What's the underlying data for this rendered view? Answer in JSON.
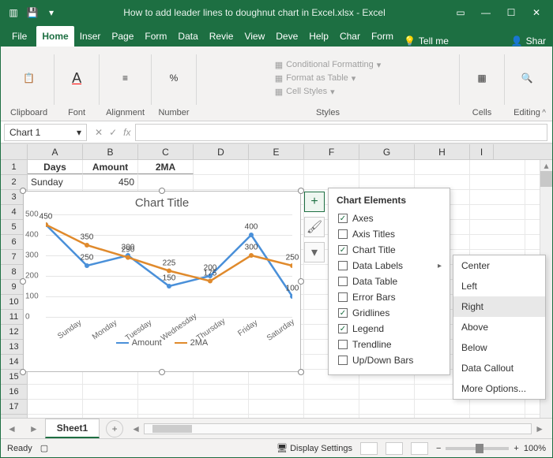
{
  "title": "How to add leader lines to doughnut chart in Excel.xlsx  -  Excel",
  "menu": {
    "file": "File",
    "home": "Home",
    "insert": "Inser",
    "page": "Page",
    "form1": "Form",
    "data": "Data",
    "review": "Revie",
    "view": "View",
    "dev": "Deve",
    "help": "Help",
    "chart": "Char",
    "format": "Form",
    "tell": "Tell me",
    "share": "Shar"
  },
  "ribbon": {
    "clipboard": "Clipboard",
    "font": "Font",
    "alignment": "Alignment",
    "number": "Number",
    "cf": "Conditional Formatting",
    "fat": "Format as Table",
    "cs": "Cell Styles",
    "styles": "Styles",
    "cells": "Cells",
    "editing": "Editing"
  },
  "namebox": "Chart 1",
  "columns": [
    "A",
    "B",
    "C",
    "D",
    "E",
    "F",
    "G",
    "H",
    "I"
  ],
  "headers": {
    "days": "Days",
    "amount": "Amount",
    "ma2": "2MA"
  },
  "row2": {
    "a": "Sunday",
    "b": "450"
  },
  "chart_data": {
    "type": "line",
    "title": "Chart Title",
    "categories": [
      "Sunday",
      "Monday",
      "Tuesday",
      "Wednesday",
      "Thursday",
      "Friday",
      "Saturday"
    ],
    "series": [
      {
        "name": "Amount",
        "color": "#4a90d9",
        "values": [
          450,
          250,
          300,
          150,
          200,
          400,
          100
        ]
      },
      {
        "name": "2MA",
        "color": "#e08a2c",
        "values": [
          450,
          350,
          290,
          225,
          175,
          300,
          250
        ]
      }
    ],
    "ylim": [
      0,
      500
    ],
    "yticks": [
      0,
      100,
      200,
      300,
      400,
      500
    ],
    "data_labels": [
      {
        "x": 0,
        "y": 450,
        "text": "450"
      },
      {
        "x": 1,
        "y": 350,
        "text": "350"
      },
      {
        "x": 1,
        "y": 250,
        "text": "250"
      },
      {
        "x": 2,
        "y": 290,
        "text": "290"
      },
      {
        "x": 2,
        "y": 300,
        "text": "300"
      },
      {
        "x": 3,
        "y": 225,
        "text": "225"
      },
      {
        "x": 3,
        "y": 150,
        "text": "150"
      },
      {
        "x": 4,
        "y": 200,
        "text": "200"
      },
      {
        "x": 4,
        "y": 175,
        "text": "175"
      },
      {
        "x": 5,
        "y": 400,
        "text": "400"
      },
      {
        "x": 5,
        "y": 300,
        "text": "300"
      },
      {
        "x": 6,
        "y": 250,
        "text": "250"
      },
      {
        "x": 6,
        "y": 100,
        "text": "100"
      }
    ]
  },
  "flyout": {
    "title": "Chart Elements",
    "items": [
      {
        "label": "Axes",
        "checked": true
      },
      {
        "label": "Axis Titles",
        "checked": false
      },
      {
        "label": "Chart Title",
        "checked": true
      },
      {
        "label": "Data Labels",
        "checked": false,
        "arrow": true
      },
      {
        "label": "Data Table",
        "checked": false
      },
      {
        "label": "Error Bars",
        "checked": false
      },
      {
        "label": "Gridlines",
        "checked": true
      },
      {
        "label": "Legend",
        "checked": true
      },
      {
        "label": "Trendline",
        "checked": false
      },
      {
        "label": "Up/Down Bars",
        "checked": false
      }
    ]
  },
  "submenu": [
    "Center",
    "Left",
    "Right",
    "Above",
    "Below",
    "Data Callout",
    "More Options..."
  ],
  "submenu_hover": "Right",
  "sheet": "Sheet1",
  "status": {
    "ready": "Ready",
    "display": "Display Settings",
    "zoom": "100%"
  }
}
